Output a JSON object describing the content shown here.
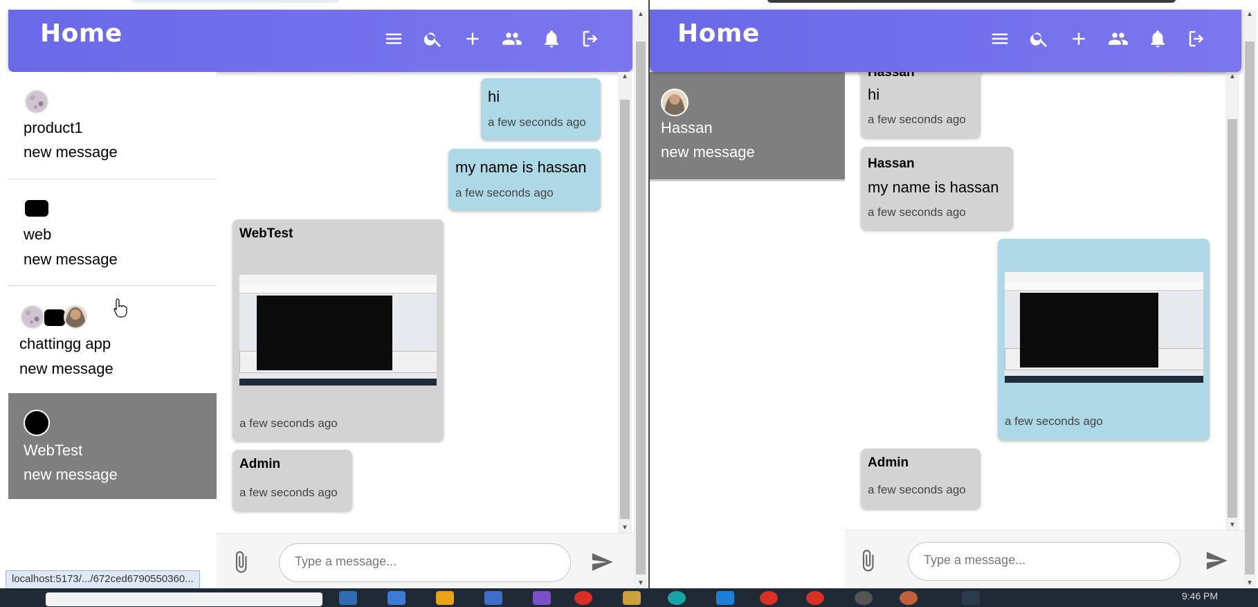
{
  "left_window": {
    "header": {
      "title": "Home"
    },
    "conversations": [
      {
        "name": "product1",
        "preview": "new message",
        "active": false
      },
      {
        "name": "web",
        "preview": "new message",
        "active": false
      },
      {
        "name": "chattingg app",
        "preview": "new message",
        "active": false
      },
      {
        "name": "WebTest",
        "preview": "new message",
        "active": true
      }
    ],
    "messages": [
      {
        "type": "outgoing",
        "text": "hi",
        "time": "a few seconds ago"
      },
      {
        "type": "outgoing",
        "text": "my name is hassan",
        "time": "a few seconds ago"
      },
      {
        "type": "incoming",
        "sender": "WebTest",
        "attachment": "image",
        "time": "a few seconds ago"
      },
      {
        "type": "incoming",
        "sender": "Admin",
        "time": "a few seconds ago"
      }
    ],
    "composer": {
      "placeholder": "Type a message..."
    },
    "status_url": "localhost:5173/.../672ced6790550360..."
  },
  "right_window": {
    "header": {
      "title": "Home"
    },
    "conversations": [
      {
        "name": "Hassan",
        "preview": "new message",
        "active": true
      }
    ],
    "messages": [
      {
        "type": "incoming",
        "sender": "Hassan",
        "text": "hi",
        "time": "a few seconds ago"
      },
      {
        "type": "incoming",
        "sender": "Hassan",
        "text": "my name is hassan",
        "time": "a few seconds ago"
      },
      {
        "type": "outgoing",
        "attachment": "image",
        "time": "a few seconds ago"
      },
      {
        "type": "incoming",
        "sender": "Admin",
        "time": "a few seconds ago"
      }
    ],
    "composer": {
      "placeholder": "Type a message..."
    }
  },
  "header_icons": [
    "menu-icon",
    "search-icon",
    "plus-icon",
    "group-icon",
    "bell-icon",
    "logout-icon"
  ],
  "os_taskbar": {
    "clock": "9:46 PM"
  },
  "colors": {
    "header_gradient_start": "#6a69e8",
    "header_gradient_end": "#7b76ee",
    "outgoing_bubble": "#add8e6",
    "incoming_bubble": "#d3d3d3",
    "active_conversation": "#7f7f7f"
  }
}
